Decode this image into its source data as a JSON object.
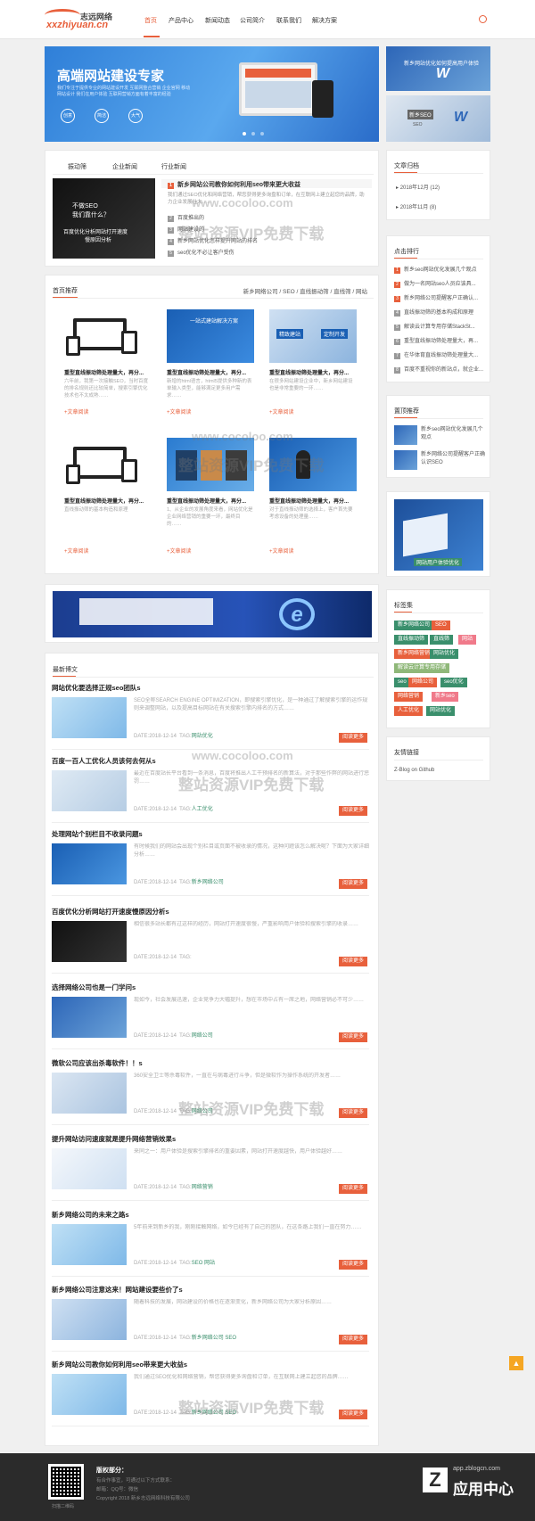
{
  "header": {
    "logo_cn": "志远网络",
    "logo_en": "xxzhiyuan.cn",
    "nav": [
      "首页",
      "产品中心",
      "新闻动态",
      "公司简介",
      "联系我们",
      "解决方案"
    ]
  },
  "banner": {
    "title": "高端网站建设专家",
    "subtitle": "我们专注于提供专业的网站建设开发 互联网整合营销 企业官网 移动网站设计 我们在用户体验 互联网营销方面有着丰富的经验",
    "circles": [
      "创意",
      "简洁",
      "大气"
    ],
    "side_text1": "新乡网站优化如何提高用户体验",
    "side_text2": "新乡SEO",
    "side_caption": "SEO"
  },
  "news_box": {
    "tabs": [
      "振动筛",
      "企业新闻",
      "行业新闻"
    ],
    "img_text1": "不做SEO",
    "img_text2": "我们靠什么？",
    "img_text3": "百度优化分析网站打开速度",
    "img_text4": "慢原因分析",
    "items": [
      {
        "n": "1",
        "t": "新乡网站公司教你如何利用seo带来更大收益"
      },
      {
        "n": "",
        "t": "我们通过SEO优化和网络营销，帮您获得更多询盘和订单，在互联网上建立起您的品牌，助力企业发展壮大……"
      },
      {
        "n": "2",
        "t": "百度推出的"
      },
      {
        "n": "3",
        "t": "网站建设的"
      },
      {
        "n": "4",
        "t": "新乡网站优化怎样提升网站的排名"
      },
      {
        "n": "5",
        "t": "seo优化不必让客户受伤"
      }
    ]
  },
  "home_rec": {
    "title": "首页推荐",
    "links": [
      "新乡网络公司",
      "SEO",
      "直线振动筛",
      "直线筛",
      "网站"
    ],
    "items": [
      {
        "t": "重型直线振动筛处理量大，再分...",
        "d": "六年前，我第一次接触SEO，当时百度的排名规则还比较简单，搜索引擎优化技术也不太成熟……",
        "m": "+文章阅读"
      },
      {
        "t": "重型直线振动筛处理量大，再分...",
        "d": "新增的html语言，html5提供多种新的表单输入类型，能够满足更多用户需求……",
        "m": "+文章阅读"
      },
      {
        "t": "重型直线振动筛处理量大，再分...",
        "d": "在很多网站建设企业中，新乡网站建设也是非常重要的一环……",
        "m": "+文章阅读"
      },
      {
        "t": "重型直线振动筛处理量大，再分...",
        "d": "直线振动筛的基本构造和原理",
        "m": "+文章阅读"
      },
      {
        "t": "重型直线振动筛处理量大，再分...",
        "d": "1、从企业的发展角度来看，网站优化是企业网络营销的重要一环，最终目的……",
        "m": "+文章阅读"
      },
      {
        "t": "重型直线振动筛处理量大，再分...",
        "d": "对于直线振动筛的选择上，客户首先要考虑设备的处理量……",
        "m": "+文章阅读"
      }
    ],
    "img_text1": "一站式建站解决方案",
    "img_text2": "精致建站",
    "img_text3": "定制开发"
  },
  "latest": {
    "title": "最新博文",
    "articles": [
      {
        "t": "网站优化要选择正规seo团队s",
        "d": "SEO全称SEARCH ENGINE OPTIMIZATION，即搜索引擎优化，是一种通过了解搜索引擎的运作规则来调整网站，以及提高目标网站在有关搜索引擎内排名的方式……",
        "date": "DATE:2018-12-14",
        "tag": "网站优化"
      },
      {
        "t": "百度一百人工优化人员该何去何从s",
        "d": "最近在百度站长平台看到一条消息，百度将推出人工干预排名的新算法，对于那些作弊的网站进行惩罚……",
        "date": "DATE:2018-12-14",
        "tag": "人工优化"
      },
      {
        "t": "处理网站个别栏目不收录问题s",
        "d": "有时候我们的网站会出现个别栏目或页面不被收录的情况，这种问题该怎么解决呢？下面为大家详细分析……",
        "date": "DATE:2018-12-14",
        "tag": "新乡网络公司"
      },
      {
        "t": "百度优化分析网站打开速度慢原因分析s",
        "d": "相信很多站长都有过这样的经历，网站打开速度很慢，严重影响用户体验和搜索引擎的收录……",
        "date": "DATE:2018-12-14",
        "tag": ""
      },
      {
        "t": "选择网络公司也是一门学问s",
        "d": "现如今，社会发展迅速，企业竞争力大幅提升，想在市场中占有一席之地，网络营销必不可少……",
        "date": "DATE:2018-12-14",
        "tag": "网络公司"
      },
      {
        "t": "微软公司应该出杀毒软件！！s",
        "d": "360安全卫士等杀毒软件，一直在与病毒进行斗争，但是微软作为操作系统的开发者……",
        "date": "DATE:2018-12-14",
        "tag": "网络公司"
      },
      {
        "t": "提升网站访问速度就是提升网络营销效果s",
        "d": "来同之一：用户体验是搜索引擎排名的重要因素，网站打开速度越快，用户体验越好……",
        "date": "DATE:2018-12-14",
        "tag": "网络营销"
      },
      {
        "t": "新乡网络公司的未来之路s",
        "d": "5年前来到新乡的我，刚刚接触网络，如今已经有了自己的团队，在这条路上我们一直在努力……",
        "date": "DATE:2018-12-14",
        "tag": "SEO 网站"
      },
      {
        "t": "新乡网络公司注意这来！网站建设要些价了s",
        "d": "随着科技的发展，网站建设的价格也在逐渐变化，新乡网络公司为大家分析原因……",
        "date": "DATE:2018-12-14",
        "tag": "新乡网络公司 SEO"
      },
      {
        "t": "新乡网站公司教你如何利用seo带来更大收益s",
        "d": "我们通过SEO优化和网络营销，帮您获得更多询盘和订单，在互联网上建立起您的品牌……",
        "date": "DATE:2018-12-14",
        "tag": "新乡网络公司 SEO"
      }
    ],
    "more": "阅读更多"
  },
  "sidebar": {
    "archive_title": "文章归档",
    "archive": [
      "2018年12月 (12)",
      "2018年11月 (8)"
    ],
    "hot_title": "点击排行",
    "hot": [
      "新乡seo网站优化发展几个观点",
      "做为一名网站seo人员应该具...",
      "新乡网络公司提醒客户正确认...",
      "直线振动筛的基本构成和原理",
      "解读云计算专用存储StackSt...",
      "重型直线振动筛处理量大，再...",
      "在华体育直线振动筛处理量大...",
      "百度不重视你的新站点，就企业..."
    ],
    "pick_title": "置顶推荐",
    "pick": [
      "新乡seo网站优化发展几个观点",
      "新乡网络公司提醒客户正确认识SEO"
    ],
    "promo": "网站用户体验优化",
    "tags_title": "标签集",
    "tags": [
      {
        "t": "新乡网络公司",
        "c": "#3a8f6c"
      },
      {
        "t": "SEO",
        "c": "#e8603c"
      },
      {
        "t": "直线振动筛",
        "c": "#3a8f6c"
      },
      {
        "t": "直线筛",
        "c": "#3a8f6c"
      },
      {
        "t": "网站",
        "c": "#f07a8a"
      },
      {
        "t": "新乡网络营销",
        "c": "#e8603c"
      },
      {
        "t": "网站优化",
        "c": "#3a8f6c"
      },
      {
        "t": "解读云计算专用存储",
        "c": "#8fb879"
      },
      {
        "t": "seo",
        "c": "#3a8f6c"
      },
      {
        "t": "网络公司",
        "c": "#e8603c"
      },
      {
        "t": "seo优化",
        "c": "#3a8f6c"
      },
      {
        "t": "网络营销",
        "c": "#e8603c"
      },
      {
        "t": "新乡seo",
        "c": "#f07a8a"
      },
      {
        "t": "人工优化",
        "c": "#e8603c"
      },
      {
        "t": "网站优化",
        "c": "#3a8f6c"
      }
    ],
    "links_title": "友情链接",
    "links": [
      "Z-Blog on Github"
    ]
  },
  "footer": {
    "title": "版权部分：",
    "lines": [
      "有合作事宜，可通过以下方式联系：",
      "邮箱：QQ号：微信",
      "Copyright 2018 新乡志远网络科技有限公司"
    ],
    "qr_caption": "扫描二维码",
    "badge": "应用中心",
    "badge_url": "app.zblogcn.com"
  },
  "watermarks": {
    "w1": "www.cocoloo.com",
    "w2": "整站资源VIP免费下载"
  },
  "colors": {
    "accent": "#e8603c",
    "green": "#3a8f6c"
  }
}
